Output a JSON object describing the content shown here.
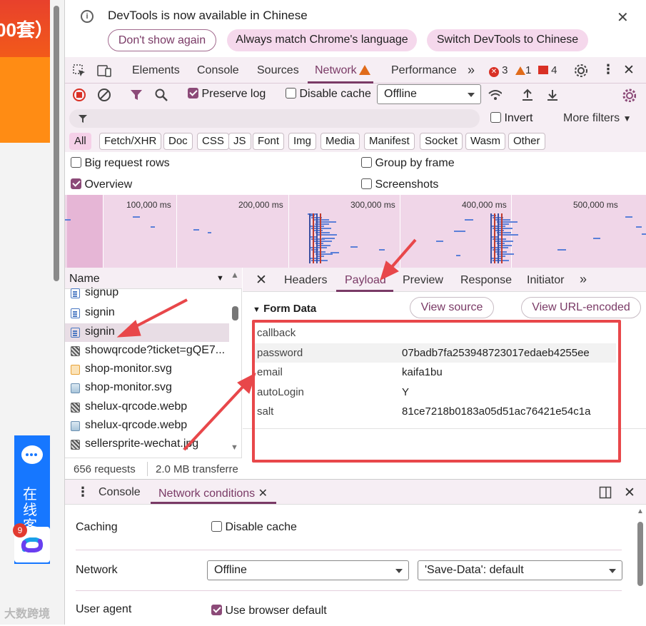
{
  "webpage": {
    "promo_text": "00套）",
    "chat_label": "在线客服",
    "badge_count": "9",
    "watermark": "大数跨境"
  },
  "infobar": {
    "message": "DevTools is now available in Chinese",
    "btn_dont_show": "Don't show again",
    "btn_match": "Always match Chrome's language",
    "btn_switch": "Switch DevTools to Chinese"
  },
  "main_tabs": {
    "items": [
      "Elements",
      "Console",
      "Sources",
      "Network",
      "Performance"
    ],
    "more": "»",
    "errors": "3",
    "warnings": "1",
    "issues": "4"
  },
  "toolbar": {
    "preserve_log": "Preserve log",
    "disable_cache": "Disable cache",
    "throttle_value": "Offline"
  },
  "filter": {
    "invert": "Invert",
    "more_filters": "More filters",
    "types": [
      "All",
      "Fetch/XHR",
      "Doc",
      "CSS",
      "JS",
      "Font",
      "Img",
      "Media",
      "Manifest",
      "Socket",
      "Wasm",
      "Other"
    ]
  },
  "options": {
    "big_rows": "Big request rows",
    "group_frame": "Group by frame",
    "overview": "Overview",
    "screenshots": "Screenshots"
  },
  "overview": {
    "ticks": [
      "100,000 ms",
      "200,000 ms",
      "300,000 ms",
      "400,000 ms",
      "500,000 ms"
    ]
  },
  "requests": {
    "column": "Name",
    "rows": [
      {
        "name": "signup"
      },
      {
        "name": "signin"
      },
      {
        "name": "signin"
      },
      {
        "name": "showqrcode?ticket=gQE7..."
      },
      {
        "name": "shop-monitor.svg"
      },
      {
        "name": "shop-monitor.svg"
      },
      {
        "name": "shelux-qrcode.webp"
      },
      {
        "name": "shelux-qrcode.webp"
      },
      {
        "name": "sellersprite-wechat.jpg"
      }
    ],
    "count": "656 requests",
    "transferred": "2.0 MB transferre"
  },
  "detail": {
    "tabs": [
      "Headers",
      "Payload",
      "Preview",
      "Response",
      "Initiator"
    ],
    "section": "Form Data",
    "view_source": "View source",
    "view_url": "View URL-encoded",
    "form": [
      {
        "key": "callback",
        "value": ""
      },
      {
        "key": "password",
        "value": "07badb7fa253948723017edaeb4255ee"
      },
      {
        "key": "email",
        "value": "kaifa1bu"
      },
      {
        "key": "autoLogin",
        "value": "Y"
      },
      {
        "key": "salt",
        "value": "81ce7218b0183a05d51ac76421e54c1a"
      }
    ]
  },
  "drawer": {
    "console": "Console",
    "network_conditions": "Network conditions"
  },
  "network_conditions": {
    "caching_label": "Caching",
    "disable_cache": "Disable cache",
    "network_label": "Network",
    "network_value": "Offline",
    "save_data_value": "'Save-Data': default",
    "ua_label": "User agent",
    "ua_default": "Use browser default"
  },
  "colors": {
    "accent": "#7a3a66",
    "annotation_red": "#e8474a",
    "toolbar_bg": "#f6eef4"
  }
}
